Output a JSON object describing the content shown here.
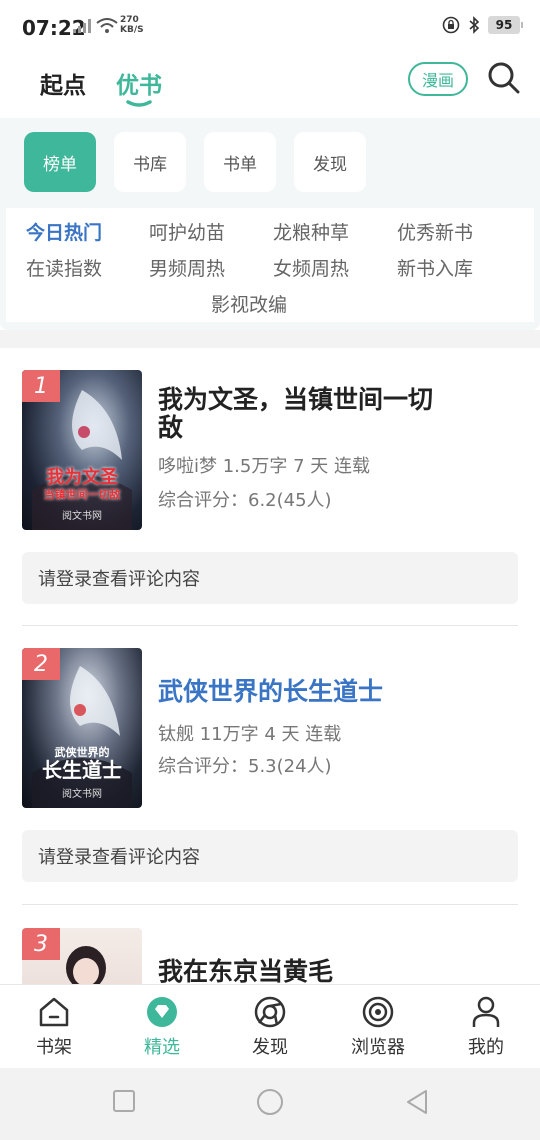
{
  "status_bar": {
    "time": "07:22",
    "speed_value": "270",
    "speed_unit": "KB/S",
    "battery": "95"
  },
  "header": {
    "tabs": [
      {
        "label": "起点",
        "active": false
      },
      {
        "label": "优书",
        "active": true
      }
    ],
    "manga_button": "漫画",
    "accent_color": "#3fb79a"
  },
  "pills": [
    {
      "label": "榜单",
      "active": true
    },
    {
      "label": "书库",
      "active": false
    },
    {
      "label": "书单",
      "active": false
    },
    {
      "label": "发现",
      "active": false
    }
  ],
  "rank_tabs": [
    {
      "label": "今日热门",
      "active": true
    },
    {
      "label": "呵护幼苗",
      "active": false
    },
    {
      "label": "龙粮种草",
      "active": false
    },
    {
      "label": "优秀新书",
      "active": false
    },
    {
      "label": "在读指数",
      "active": false
    },
    {
      "label": "男频周热",
      "active": false
    },
    {
      "label": "女频周热",
      "active": false
    },
    {
      "label": "新书入库",
      "active": false
    },
    {
      "label": "影视改编",
      "active": false
    }
  ],
  "books": [
    {
      "rank": "1",
      "title": "我为文圣，当镇世间一切敌",
      "meta": "哆啦i梦 1.5万字 7 天 连载",
      "score": "综合评分：6.2(45人)",
      "comment": "请登录查看评论内容",
      "cover_text": "我为文圣",
      "cover_sub": "当镇世间一切敌",
      "cover_publisher": "阅文书网"
    },
    {
      "rank": "2",
      "title": "武侠世界的长生道士",
      "meta": "钛舰 11万字 4 天 连载",
      "score": "综合评分：5.3(24人)",
      "comment": "请登录查看评论内容",
      "cover_text": "长生道士",
      "cover_sub": "武侠世界的",
      "cover_publisher": "阅文书网"
    },
    {
      "rank": "3",
      "title": "我在东京当黄毛"
    }
  ],
  "bottom_nav": [
    {
      "label": "书架",
      "icon": "house-icon",
      "active": false
    },
    {
      "label": "精选",
      "icon": "gem-icon",
      "active": true
    },
    {
      "label": "发现",
      "icon": "compass-icon",
      "active": false
    },
    {
      "label": "浏览器",
      "icon": "browser-icon",
      "active": false
    },
    {
      "label": "我的",
      "icon": "person-icon",
      "active": false
    }
  ]
}
